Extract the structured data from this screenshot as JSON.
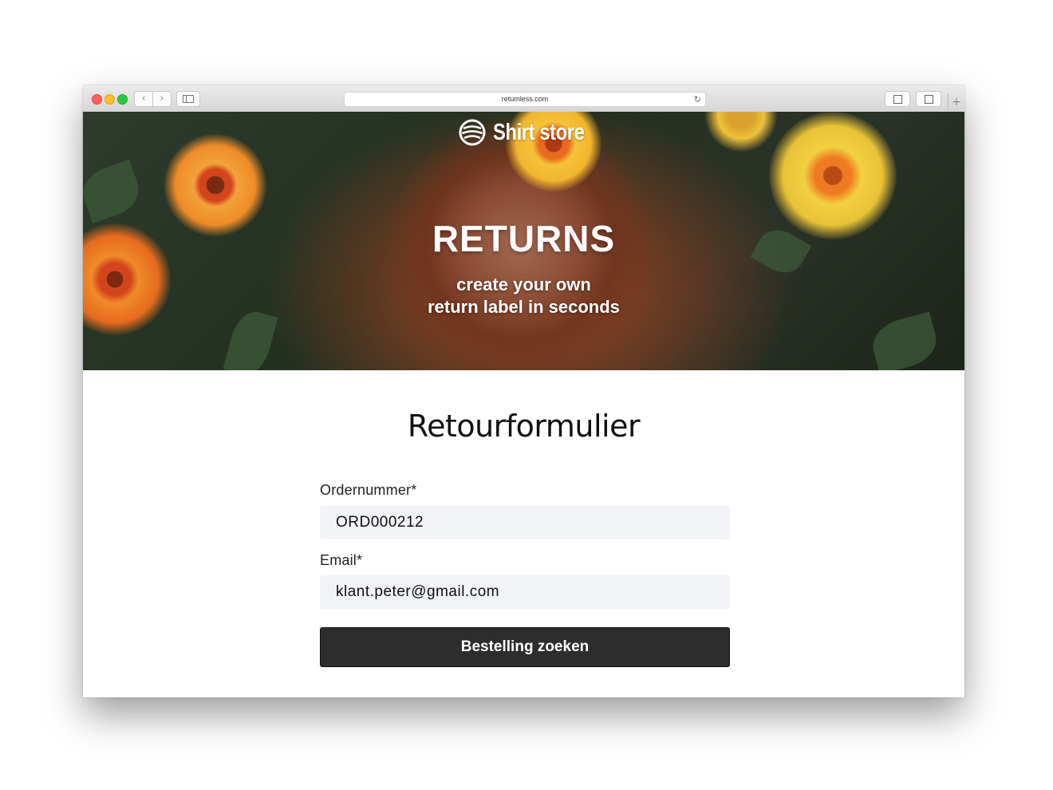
{
  "browser": {
    "url": "retumless.com",
    "back_glyph": "‹",
    "forward_glyph": "›",
    "reload_glyph": "↻",
    "newtab_glyph": "+"
  },
  "hero": {
    "brand": "Shirt store",
    "title": "RETURNS",
    "subtitle_line1": "create your own",
    "subtitle_line2": "return label in seconds"
  },
  "form": {
    "title": "Retourformulier",
    "order_label": "Ordernummer*",
    "order_value": "ORD000212",
    "email_label": "Email*",
    "email_value": "klant.peter@gmail.com",
    "submit_label": "Bestelling zoeken"
  },
  "colors": {
    "submit_bg": "#2d2d2d",
    "field_bg": "#f1f3f7"
  }
}
